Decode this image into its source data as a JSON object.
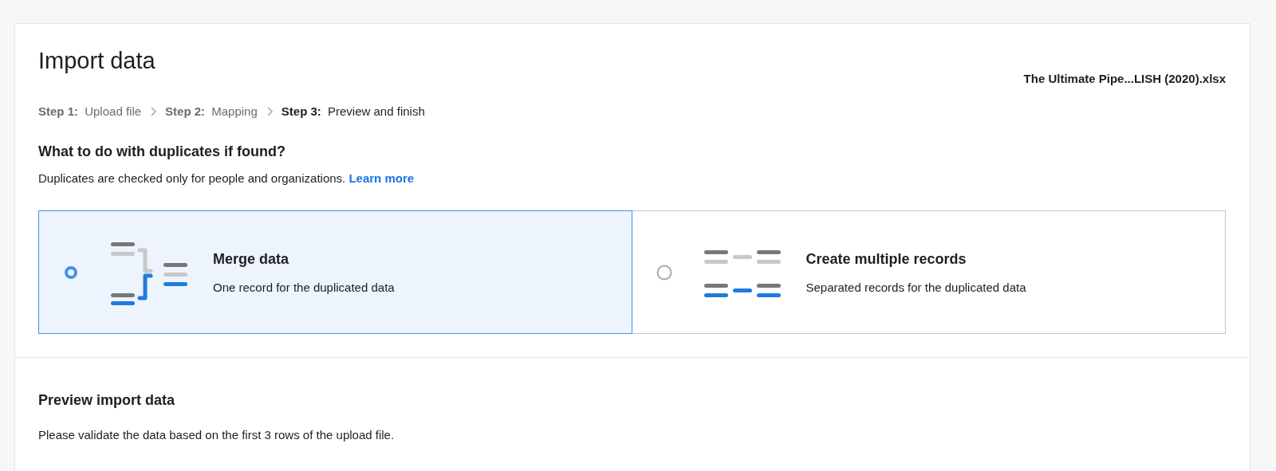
{
  "title": "Import data",
  "file_name": "The Ultimate Pipe...LISH (2020).xlsx",
  "steps": [
    {
      "label": "Step 1:",
      "name": "Upload file",
      "selected": false
    },
    {
      "label": "Step 2:",
      "name": "Mapping",
      "selected": false
    },
    {
      "label": "Step 3:",
      "name": "Preview and finish",
      "selected": true
    }
  ],
  "duplicates": {
    "heading": "What to do with duplicates if found?",
    "description": "Duplicates are checked only for people and organizations.",
    "link": "Learn more",
    "options": [
      {
        "kind": "merge",
        "title": "Merge data",
        "subtitle": "One record for the duplicated data",
        "selected": true
      },
      {
        "kind": "multiple",
        "title": "Create multiple records",
        "subtitle": "Separated records for the duplicated data",
        "selected": false
      }
    ]
  },
  "preview": {
    "heading": "Preview import data",
    "description": "Please validate the data based on the first 3 rows of the upload file."
  }
}
